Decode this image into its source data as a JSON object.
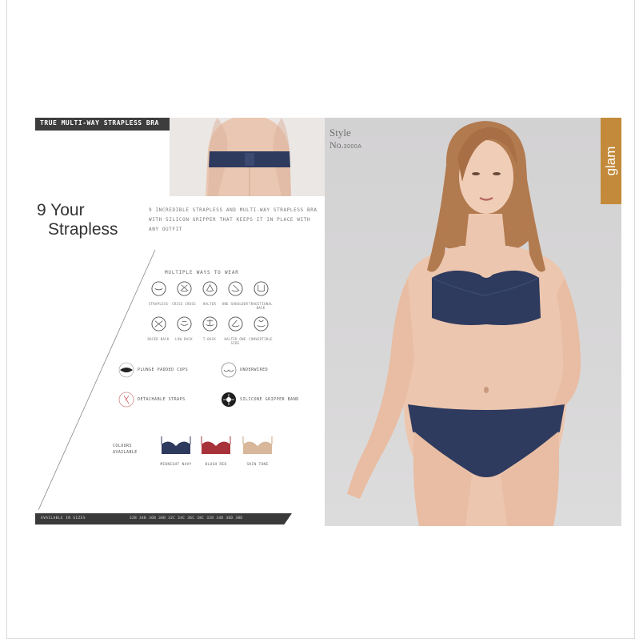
{
  "left_page": {
    "banner_title": "TRUE MULTI-WAY STRAPLESS BRA",
    "product_name_line1": "9 Your",
    "product_name_line2": "Strapless",
    "description_lines": [
      "9 INCREDIBLE STRAPLESS AND MULTI-WAY STRAPLESS BRA",
      "WITH SILICON GRIPPER THAT KEEPS IT IN PLACE WITH",
      "ANY OUTFIT"
    ],
    "ways_title": "MULTIPLE WAYS TO WEAR",
    "ways": [
      {
        "label": "STRAPLESS"
      },
      {
        "label": "CRISS CROSS"
      },
      {
        "label": "HALTER"
      },
      {
        "label": "ONE SHOULDER"
      },
      {
        "label": "TRADITIONAL BACK"
      },
      {
        "label": "RACER BACK"
      },
      {
        "label": "LOW BACK"
      },
      {
        "label": "T-BACK"
      },
      {
        "label": "HALTER ONE SIDE"
      },
      {
        "label": "CONVERTIBLE"
      }
    ],
    "features": [
      {
        "icon": "padded-cup-icon",
        "label": "PLUNGE PADDED CUPS"
      },
      {
        "icon": "wire-icon",
        "label": "UNDERWIRED"
      },
      {
        "icon": "strap-icon",
        "label": "DETACHABLE STRAPS"
      },
      {
        "icon": "silicone-band-icon",
        "label": "SILICONE GRIPPER BAND"
      }
    ],
    "colours_label": [
      "COLOURS",
      "AVAILABLE"
    ],
    "swatches": [
      {
        "name": "MIDNIGHT NAVY",
        "color": "#2e3a5e"
      },
      {
        "name": "BLUSH RED",
        "color": "#a8323a"
      },
      {
        "name": "SKIN TONE",
        "color": "#d8b79a"
      }
    ],
    "footer_left": "AVAILABLE IN SIZES",
    "footer_right": "32B 34B 36B 38B 32C 34C 36C 38C 32D 34D 36D 38D"
  },
  "right_page": {
    "style_word": "Style",
    "style_no_prefix": "No.",
    "style_no_value": "3000A",
    "brand": "glam"
  },
  "colors": {
    "navy": "#2e3a5e",
    "brand_tag": "#c28a3a",
    "dark_bar": "#3a3a3a"
  }
}
